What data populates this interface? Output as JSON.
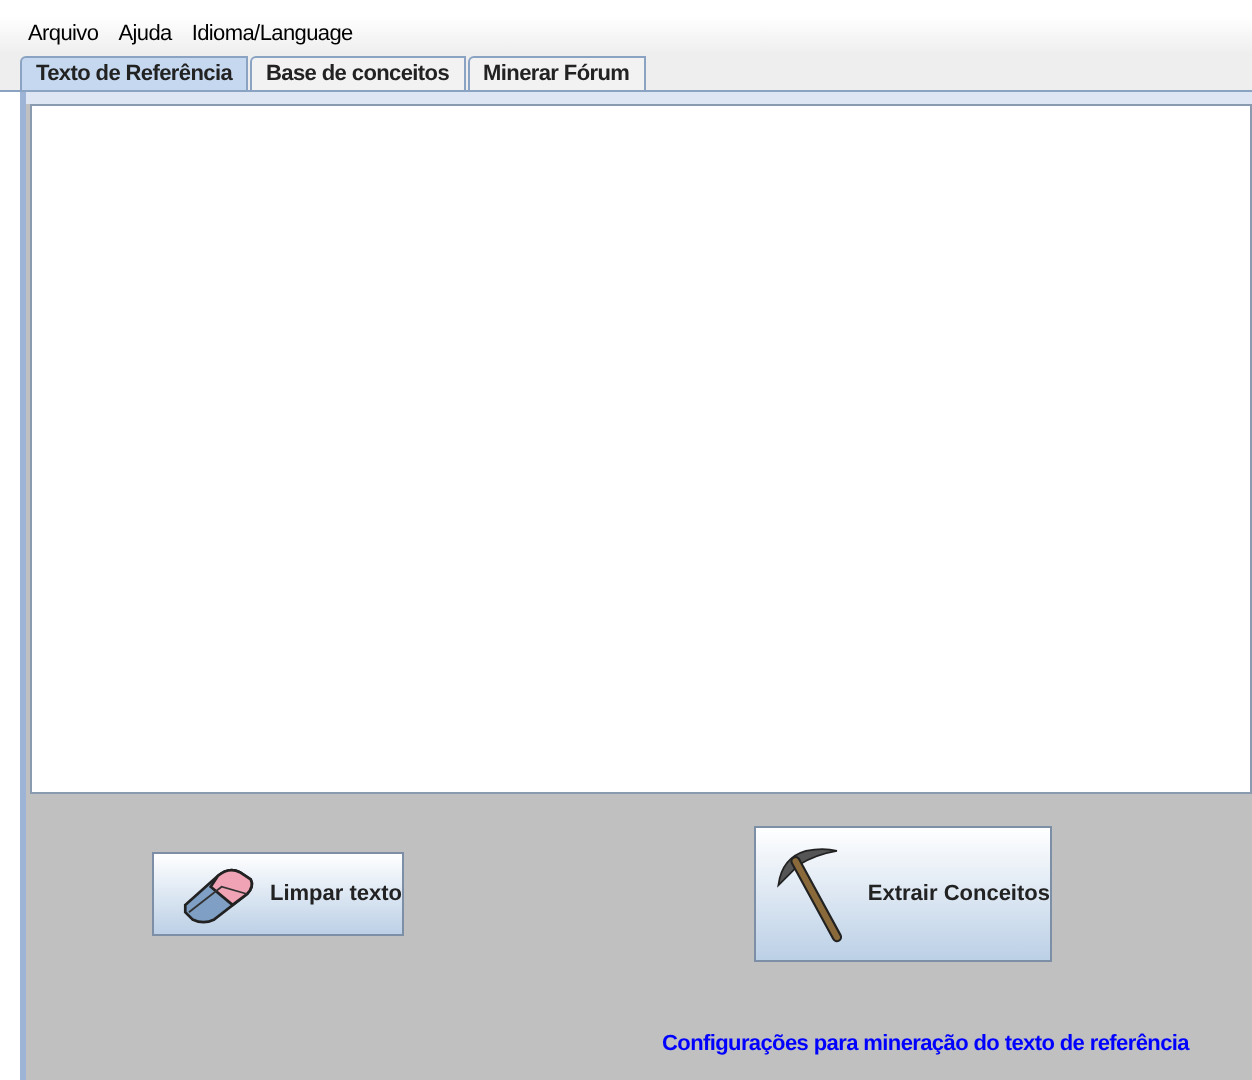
{
  "menu": [
    "Arquivo",
    "Ajuda",
    "Idioma/Language"
  ],
  "tabs": [
    {
      "label": "Texto de Referência",
      "selected": true
    },
    {
      "label": "Base de conceitos",
      "selected": false
    },
    {
      "label": "Minerar Fórum",
      "selected": false
    }
  ],
  "buttons": [
    {
      "kind": "eraser",
      "label": "Limpar texto"
    },
    {
      "kind": "pickaxe",
      "label": "Extrair Conceitos"
    }
  ],
  "link": "Configurações para mineração do texto de referência"
}
